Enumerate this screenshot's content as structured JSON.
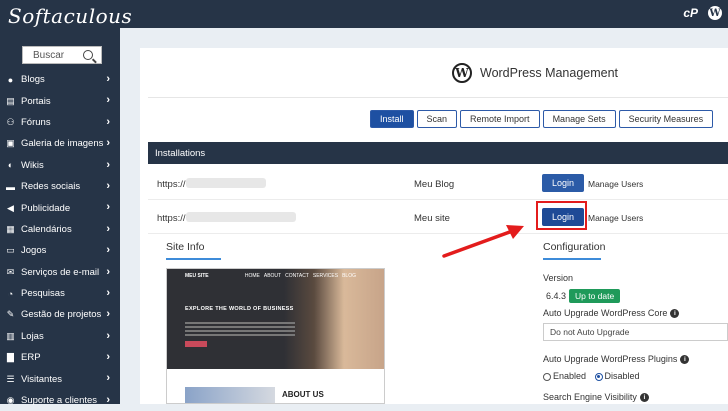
{
  "header": {
    "logo_text": "Softaculous",
    "cpanel_icon": "cP",
    "wordpress_icon": "W"
  },
  "sidebar": {
    "search_placeholder": "Buscar",
    "items": [
      {
        "label": "Blogs",
        "icon": "user-icon"
      },
      {
        "label": "Portais",
        "icon": "portal-icon"
      },
      {
        "label": "Fóruns",
        "icon": "users-icon"
      },
      {
        "label": "Galeria de imagens",
        "icon": "image-icon"
      },
      {
        "label": "Wikis",
        "icon": "globe-icon"
      },
      {
        "label": "Redes sociais",
        "icon": "comments-icon"
      },
      {
        "label": "Publicidade",
        "icon": "megaphone-icon"
      },
      {
        "label": "Calendários",
        "icon": "calendar-icon"
      },
      {
        "label": "Jogos",
        "icon": "gamepad-icon"
      },
      {
        "label": "Serviços de e-mail",
        "icon": "envelope-icon"
      },
      {
        "label": "Pesquisas",
        "icon": "pie-chart-icon"
      },
      {
        "label": "Gestão de projetos",
        "icon": "pencil-icon"
      },
      {
        "label": "Lojas",
        "icon": "cart-icon"
      },
      {
        "label": "ERP",
        "icon": "bar-chart-icon"
      },
      {
        "label": "Visitantes",
        "icon": "list-icon"
      },
      {
        "label": "Suporte a clientes",
        "icon": "support-icon"
      }
    ]
  },
  "main": {
    "title": "WordPress Management",
    "tabs": [
      {
        "label": "Install",
        "active": true
      },
      {
        "label": "Scan",
        "active": false
      },
      {
        "label": "Remote Import",
        "active": false
      },
      {
        "label": "Manage Sets",
        "active": false
      },
      {
        "label": "Security Measures",
        "active": false
      }
    ],
    "installations_header": "Installations",
    "installations": [
      {
        "url_prefix": "https://",
        "site": "Meu Blog",
        "login": "Login",
        "manage": "Manage Users"
      },
      {
        "url_prefix": "https://",
        "site": "Meu site",
        "login": "Login",
        "manage": "Manage Users"
      }
    ],
    "site_info_title": "Site Info",
    "preview": {
      "brand": "MEU SITE",
      "nav": [
        "HOME",
        "ABOUT",
        "CONTACT",
        "SERVICES",
        "BLOG"
      ],
      "headline": "EXPLORE THE WORLD OF BUSINESS",
      "about": "ABOUT US"
    },
    "configuration": {
      "title": "Configuration",
      "version_label": "Version",
      "version_value": "6.4.3",
      "version_status": "Up to date",
      "auto_core_label": "Auto Upgrade WordPress Core",
      "auto_core_value": "Do not Auto Upgrade",
      "auto_plugins_label": "Auto Upgrade WordPress Plugins",
      "plugins_enabled": "Enabled",
      "plugins_disabled": "Disabled",
      "search_visibility_label": "Search Engine Visibility"
    }
  },
  "colors": {
    "sidebar_bg": "#263447",
    "accent_blue": "#1e50a2",
    "success_green": "#1f9a5a",
    "highlight_red": "#e31c1c"
  }
}
